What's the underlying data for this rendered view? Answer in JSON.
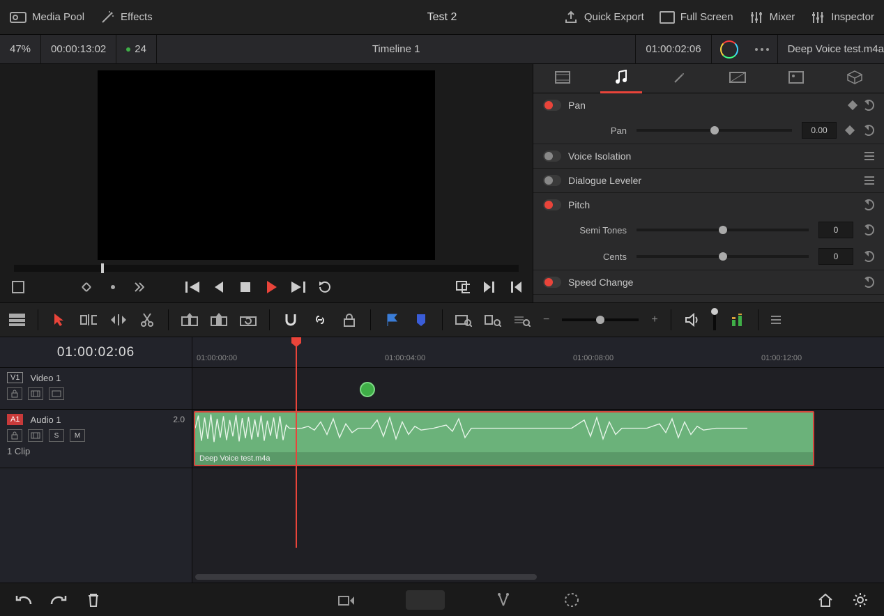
{
  "topbar": {
    "media_pool": "Media Pool",
    "effects": "Effects",
    "title": "Test 2",
    "quick_export": "Quick Export",
    "full_screen": "Full Screen",
    "mixer": "Mixer",
    "inspector": "Inspector"
  },
  "subbar": {
    "zoom": "47%",
    "duration": "00:00:13:02",
    "fps": "24",
    "timeline_name": "Timeline 1",
    "timecode": "01:00:02:06",
    "clip_name": "Deep Voice test.m4a"
  },
  "inspector_panel": {
    "sections": {
      "pan": {
        "title": "Pan",
        "param_label": "Pan",
        "value": "0.00"
      },
      "voice_isolation": {
        "title": "Voice Isolation"
      },
      "dialogue_leveler": {
        "title": "Dialogue Leveler"
      },
      "pitch": {
        "title": "Pitch",
        "semi_label": "Semi Tones",
        "semi_value": "0",
        "cents_label": "Cents",
        "cents_value": "0"
      },
      "speed_change": {
        "title": "Speed Change"
      }
    }
  },
  "timeline": {
    "current_tc": "01:00:02:06",
    "ruler": [
      "01:00:00:00",
      "01:00:04:00",
      "01:00:08:00",
      "01:00:12:00"
    ],
    "video_track": {
      "badge": "V1",
      "name": "Video 1"
    },
    "audio_track": {
      "badge": "A1",
      "name": "Audio 1",
      "gain": "2.0",
      "solo": "S",
      "mute": "M"
    },
    "clip_count": "1 Clip",
    "clip_label": "Deep Voice test.m4a"
  }
}
